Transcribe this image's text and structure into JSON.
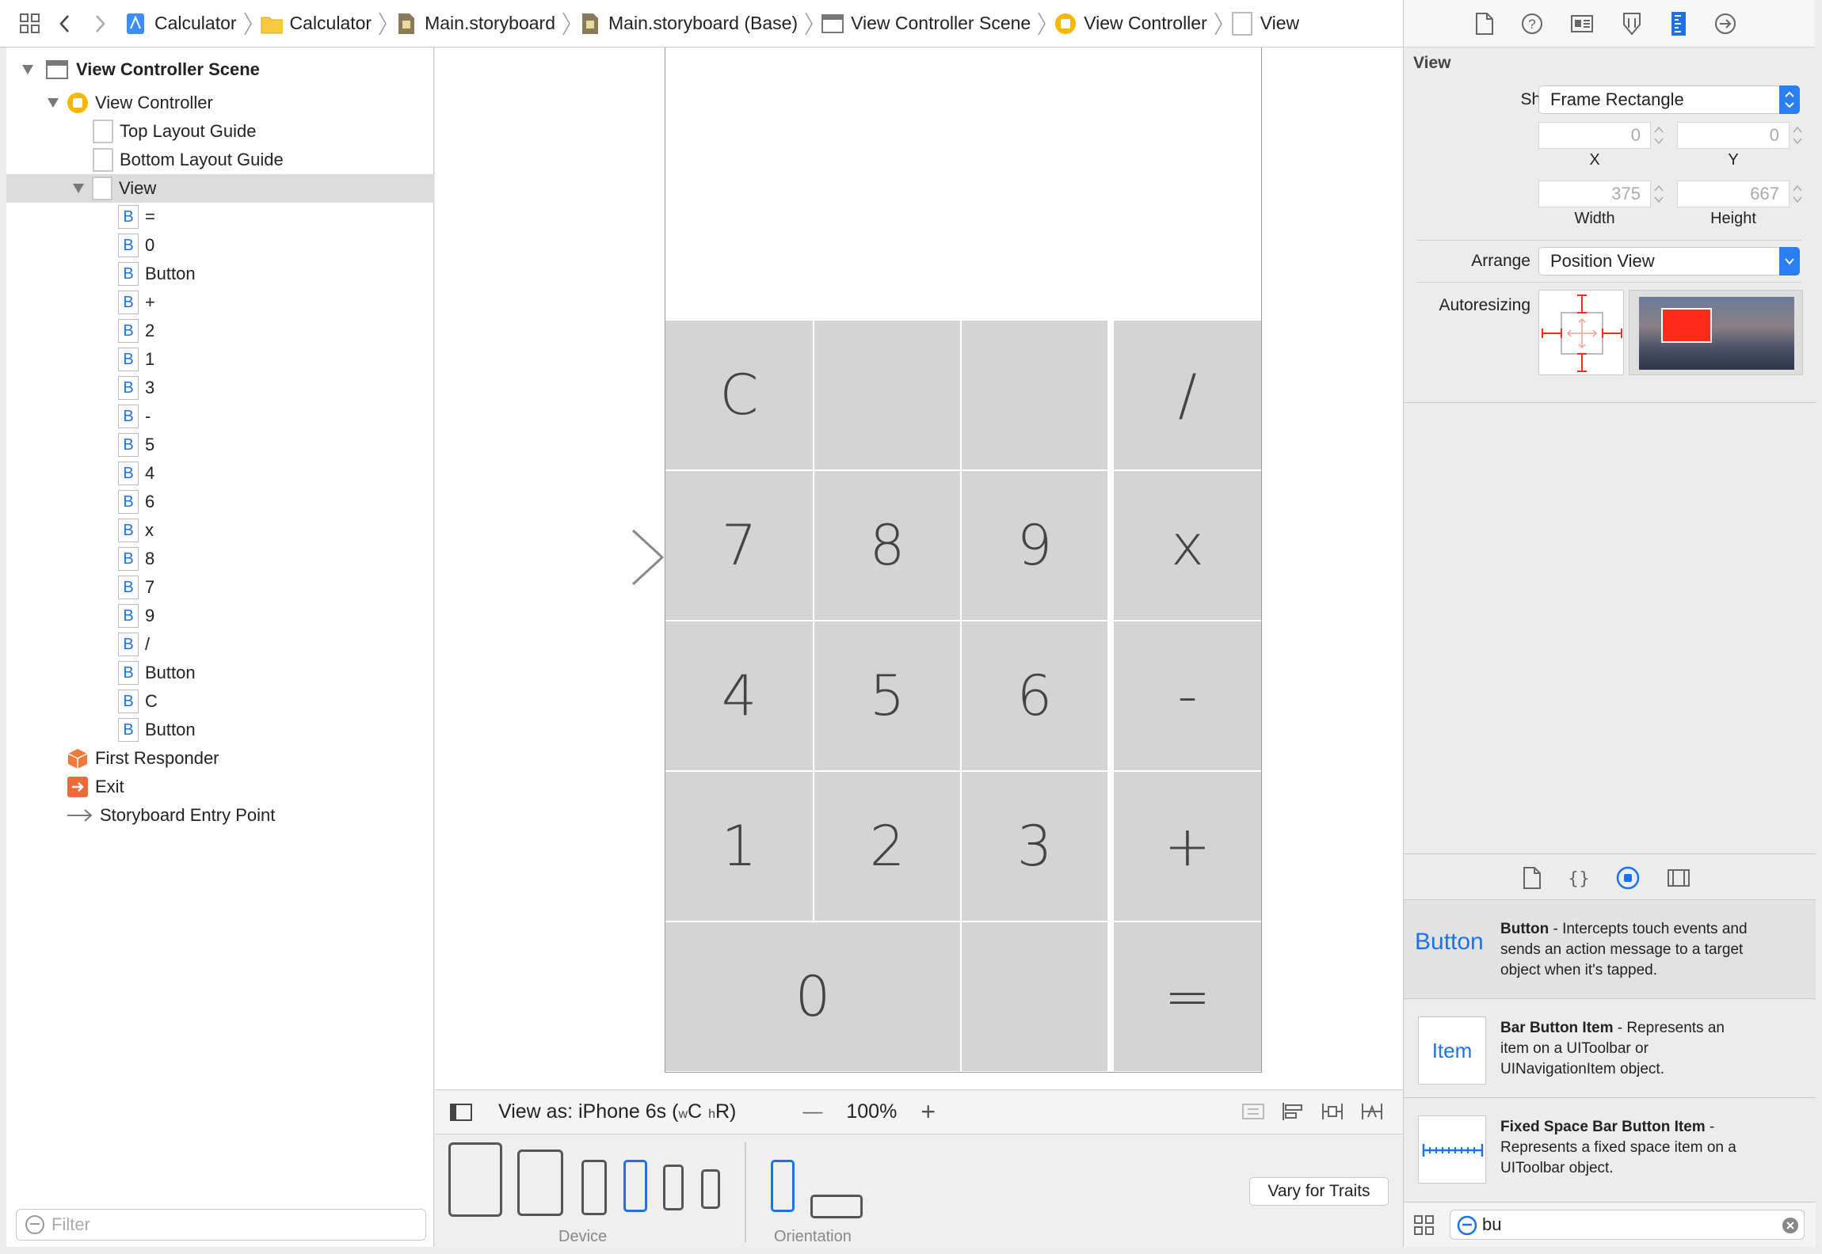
{
  "breadcrumbs": [
    {
      "label": "Calculator",
      "icon": "app-icon"
    },
    {
      "label": "Calculator",
      "icon": "folder-icon"
    },
    {
      "label": "Main.storyboard",
      "icon": "storyboard-icon"
    },
    {
      "label": "Main.storyboard (Base)",
      "icon": "storyboard-icon"
    },
    {
      "label": "View Controller Scene",
      "icon": "scene-icon"
    },
    {
      "label": "View Controller",
      "icon": "view-controller-icon"
    },
    {
      "label": "View",
      "icon": "view-icon"
    }
  ],
  "outline": {
    "scene": "View Controller Scene",
    "view_controller": "View Controller",
    "top_guide": "Top Layout Guide",
    "bottom_guide": "Bottom Layout Guide",
    "view": "View",
    "button_badge": "B",
    "buttons": [
      "=",
      "0",
      "Button",
      "+",
      "2",
      "1",
      "3",
      "-",
      "5",
      "4",
      "6",
      "x",
      "8",
      "7",
      "9",
      "/",
      "Button",
      "C",
      "Button"
    ],
    "first_responder": "First Responder",
    "exit": "Exit",
    "entry_point": "Storyboard Entry Point"
  },
  "filter": {
    "placeholder": "Filter"
  },
  "calculator": {
    "rows": [
      [
        "C",
        "",
        "",
        "/"
      ],
      [
        "7",
        "8",
        "9",
        "x"
      ],
      [
        "4",
        "5",
        "6",
        "-"
      ],
      [
        "1",
        "2",
        "3",
        "+"
      ],
      [
        "0",
        "",
        "="
      ]
    ]
  },
  "canvas_bar": {
    "view_as_prefix": "View as: iPhone 6s (",
    "w_small": "w",
    "w_big": "C",
    "h_small": "h",
    "h_big": "R",
    "suffix": ")",
    "zoom_minus": "—",
    "zoom": "100%",
    "zoom_plus": "+"
  },
  "device_bar": {
    "device_label": "Device",
    "orientation_label": "Orientation",
    "vary_button": "Vary for Traits"
  },
  "inspector": {
    "section_title": "View",
    "show_label": "Show",
    "show_value": "Frame Rectangle",
    "x_value": "0",
    "y_value": "0",
    "x_label": "X",
    "y_label": "Y",
    "width_value": "375",
    "height_value": "667",
    "width_label": "Width",
    "height_label": "Height",
    "arrange_label": "Arrange",
    "arrange_value": "Position View",
    "autoresizing_label": "Autoresizing"
  },
  "library": {
    "items": [
      {
        "thumb": "Button",
        "title": "Button",
        "desc1": " - Intercepts touch events and",
        "desc2": "sends an action message to a target",
        "desc3": "object when it's tapped."
      },
      {
        "thumb": "Item",
        "title": "Bar Button Item",
        "desc1": " - Represents an",
        "desc2": "item on a UIToolbar or",
        "desc3": "UINavigationItem object."
      },
      {
        "thumb": "",
        "title": "Fixed Space Bar Button Item",
        "desc1": " -",
        "desc2": "Represents a fixed space item on a",
        "desc3": "UIToolbar object."
      }
    ],
    "search_value": "bu"
  },
  "colors": {
    "accent": "#1a73e8",
    "button_gray": "#d4d4d4",
    "autoresize_red": "#ff2a1a"
  }
}
